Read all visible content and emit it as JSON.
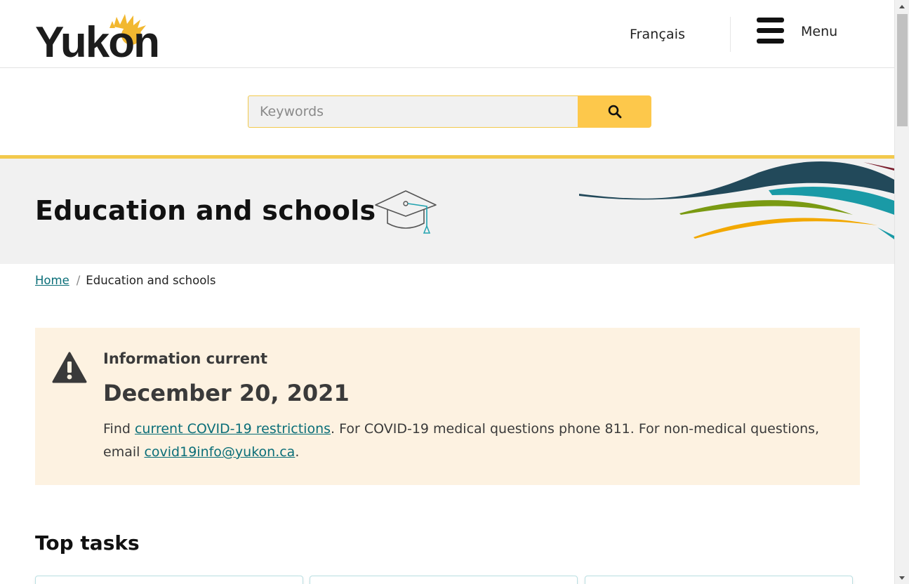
{
  "header": {
    "logo_text": "Yukon",
    "language_link": "Français",
    "menu_label": "Menu"
  },
  "search": {
    "placeholder": "Keywords",
    "button_icon": "search-icon"
  },
  "hero": {
    "title": "Education and schools",
    "icon": "graduation-cap-icon"
  },
  "breadcrumb": {
    "home": "Home",
    "current": "Education and schools"
  },
  "alert": {
    "icon": "warning-icon",
    "label": "Information current",
    "date": "December 20, 2021",
    "text_find": "Find",
    "link_restrictions": "current COVID-19 restrictions",
    "text_middle": ". For COVID-19 medical questions phone 811. For non-medical questions, email",
    "link_email": "covid19info@yukon.ca",
    "text_end": "."
  },
  "top_tasks": {
    "heading": "Top tasks"
  },
  "colors": {
    "brand_yellow": "#fdc84b",
    "link_teal": "#0a6e78",
    "alert_background": "#fdf2e1",
    "hero_background": "#f1f1f1"
  }
}
